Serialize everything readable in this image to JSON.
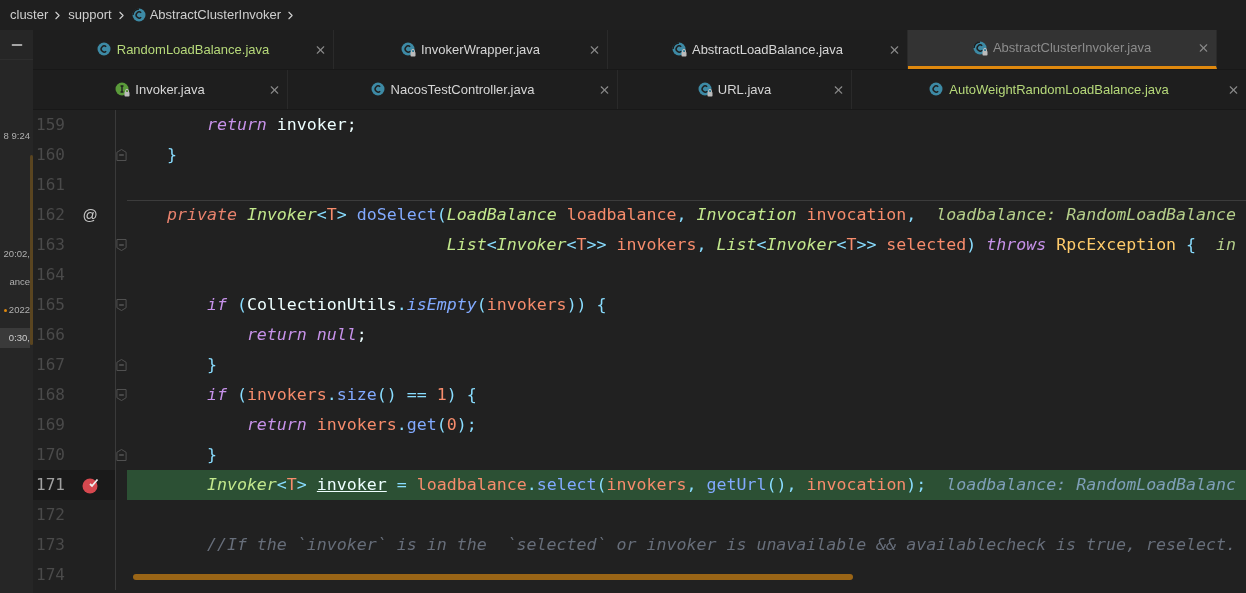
{
  "breadcrumb": [
    {
      "text": "cluster",
      "kind": "plain"
    },
    {
      "text": "support",
      "kind": "plain"
    },
    {
      "text": "AbstractClusterInvoker",
      "kind": "abstract"
    }
  ],
  "left_panel": {
    "items": [
      {
        "text": "8 9:24",
        "selected": false
      },
      {
        "text": "20:02,",
        "selected": false
      },
      {
        "text": "ance",
        "selected": false
      },
      {
        "text": "2022",
        "marker": true,
        "selected": false
      },
      {
        "text": "0:30,",
        "selected": true
      }
    ]
  },
  "tab_rows": [
    {
      "tabs": [
        {
          "label": "RandomLoadBalance.java",
          "kind": "class",
          "locked": false,
          "added": true,
          "selected": false
        },
        {
          "label": "InvokerWrapper.java",
          "kind": "class",
          "locked": true,
          "added": false,
          "selected": false
        },
        {
          "label": "AbstractLoadBalance.java",
          "kind": "abstract",
          "locked": true,
          "added": false,
          "selected": false
        },
        {
          "label": "AbstractClusterInvoker.java",
          "kind": "abstract",
          "locked": true,
          "added": false,
          "selected": true
        }
      ]
    },
    {
      "tabs": [
        {
          "label": "Invoker.java",
          "kind": "interface",
          "locked": true,
          "added": false,
          "selected": false
        },
        {
          "label": "NacosTestController.java",
          "kind": "class",
          "locked": false,
          "added": false,
          "selected": false
        },
        {
          "label": "URL.java",
          "kind": "class",
          "locked": true,
          "added": false,
          "selected": false
        },
        {
          "label": "AutoWeightRandomLoadBalance.java",
          "kind": "class",
          "locked": false,
          "added": true,
          "selected": false
        }
      ]
    }
  ],
  "editor": {
    "lines": [
      {
        "number": "159",
        "kind": "plain",
        "current": false,
        "breakpoint": false,
        "code": [
          {
            "text": "        return",
            "kind": "kw"
          },
          {
            "text": " invoker;",
            "kind": "plain"
          }
        ]
      },
      {
        "number": "160",
        "kind": "fold_end",
        "current": false,
        "breakpoint": false,
        "code": [
          {
            "text": "    }",
            "kind": "punct"
          }
        ]
      },
      {
        "number": "161",
        "kind": "plain",
        "current": false,
        "breakpoint": false
      },
      {
        "number": "162",
        "kind": "plain",
        "current": false,
        "breakpoint": false,
        "separator_above": true,
        "annotation": "@",
        "code": [
          {
            "text": "    private",
            "kind": "mod"
          },
          {
            "text": " Invoker",
            "kind": "type"
          },
          {
            "text": "<",
            "kind": "punct"
          },
          {
            "text": "T",
            "kind": "tparam"
          },
          {
            "text": ">",
            "kind": "punct"
          },
          {
            "text": " doSelect",
            "kind": "method"
          },
          {
            "text": "(",
            "kind": "punct"
          },
          {
            "text": "LoadBalance",
            "kind": "type"
          },
          {
            "text": " loadbalance",
            "kind": "param"
          },
          {
            "text": ", ",
            "kind": "punct"
          },
          {
            "text": "Invocation",
            "kind": "type"
          },
          {
            "text": " invocation",
            "kind": "param"
          },
          {
            "text": ",",
            "kind": "punct"
          },
          {
            "text": "  loadbalance: RandomLoadBalance",
            "kind": "hint"
          }
        ]
      },
      {
        "number": "163",
        "kind": "fold_start",
        "current": false,
        "breakpoint": false,
        "code": [
          {
            "text": "                                List",
            "kind": "type"
          },
          {
            "text": "<",
            "kind": "punct"
          },
          {
            "text": "Invoker",
            "kind": "type"
          },
          {
            "text": "<",
            "kind": "punct"
          },
          {
            "text": "T",
            "kind": "tparam"
          },
          {
            "text": ">>",
            "kind": "punct"
          },
          {
            "text": " invokers",
            "kind": "param"
          },
          {
            "text": ", ",
            "kind": "punct"
          },
          {
            "text": "List",
            "kind": "type"
          },
          {
            "text": "<",
            "kind": "punct"
          },
          {
            "text": "Invoker",
            "kind": "type"
          },
          {
            "text": "<",
            "kind": "punct"
          },
          {
            "text": "T",
            "kind": "tparam"
          },
          {
            "text": ">>",
            "kind": "punct"
          },
          {
            "text": " selected",
            "kind": "param"
          },
          {
            "text": ")",
            "kind": "punct"
          },
          {
            "text": " throws",
            "kind": "kw"
          },
          {
            "text": " RpcException",
            "kind": "cls"
          },
          {
            "text": " {",
            "kind": "punct"
          },
          {
            "text": "  in",
            "kind": "hint"
          }
        ]
      },
      {
        "number": "164",
        "kind": "plain",
        "current": false,
        "breakpoint": false
      },
      {
        "number": "165",
        "kind": "fold_start",
        "current": false,
        "breakpoint": false,
        "code": [
          {
            "text": "        if",
            "kind": "kw"
          },
          {
            "text": " (",
            "kind": "punct"
          },
          {
            "text": "CollectionUtils",
            "kind": "plain"
          },
          {
            "text": ".",
            "kind": "punct"
          },
          {
            "text": "isEmpty",
            "kind": "method_static"
          },
          {
            "text": "(",
            "kind": "punct"
          },
          {
            "text": "invokers",
            "kind": "param"
          },
          {
            "text": ")) {",
            "kind": "punct"
          }
        ]
      },
      {
        "number": "166",
        "kind": "plain",
        "current": false,
        "breakpoint": false,
        "code": [
          {
            "text": "            return",
            "kind": "kw"
          },
          {
            "text": " null",
            "kind": "kw"
          },
          {
            "text": ";",
            "kind": "plain"
          }
        ]
      },
      {
        "number": "167",
        "kind": "fold_end",
        "current": false,
        "breakpoint": false,
        "code": [
          {
            "text": "        }",
            "kind": "punct"
          }
        ]
      },
      {
        "number": "168",
        "kind": "fold_start",
        "current": false,
        "breakpoint": false,
        "code": [
          {
            "text": "        if",
            "kind": "kw"
          },
          {
            "text": " (",
            "kind": "punct"
          },
          {
            "text": "invokers",
            "kind": "param"
          },
          {
            "text": ".",
            "kind": "punct"
          },
          {
            "text": "size",
            "kind": "method"
          },
          {
            "text": "() ==",
            "kind": "punct"
          },
          {
            "text": " 1",
            "kind": "num"
          },
          {
            "text": ") {",
            "kind": "punct"
          }
        ]
      },
      {
        "number": "169",
        "kind": "plain",
        "current": false,
        "breakpoint": false,
        "code": [
          {
            "text": "            return",
            "kind": "kw"
          },
          {
            "text": " invokers",
            "kind": "param"
          },
          {
            "text": ".",
            "kind": "punct"
          },
          {
            "text": "get",
            "kind": "method"
          },
          {
            "text": "(",
            "kind": "punct"
          },
          {
            "text": "0",
            "kind": "num"
          },
          {
            "text": ");",
            "kind": "punct"
          }
        ]
      },
      {
        "number": "170",
        "kind": "fold_end",
        "current": false,
        "breakpoint": false,
        "code": [
          {
            "text": "        }",
            "kind": "punct"
          }
        ]
      },
      {
        "number": "171",
        "kind": "plain",
        "current": true,
        "breakpoint": true,
        "code": [
          {
            "text": "        Invoker",
            "kind": "type"
          },
          {
            "text": "<",
            "kind": "punct"
          },
          {
            "text": "T",
            "kind": "tparam"
          },
          {
            "text": "> ",
            "kind": "punct"
          },
          {
            "text": "invoker",
            "kind": "var_def"
          },
          {
            "text": " =",
            "kind": "punct"
          },
          {
            "text": " loadbalance",
            "kind": "param"
          },
          {
            "text": ".",
            "kind": "punct"
          },
          {
            "text": "select",
            "kind": "method"
          },
          {
            "text": "(",
            "kind": "punct"
          },
          {
            "text": "invokers",
            "kind": "param"
          },
          {
            "text": ", ",
            "kind": "punct"
          },
          {
            "text": "getUrl",
            "kind": "method"
          },
          {
            "text": "(), ",
            "kind": "punct"
          },
          {
            "text": "invocation",
            "kind": "param"
          },
          {
            "text": ");",
            "kind": "punct"
          },
          {
            "text": "  loadbalance: RandomLoadBalanc",
            "kind": "hint"
          }
        ]
      },
      {
        "number": "172",
        "kind": "plain",
        "current": false,
        "breakpoint": false
      },
      {
        "number": "173",
        "kind": "plain",
        "current": false,
        "breakpoint": false,
        "code": [
          {
            "text": "        //If the `invoker` is in the  `selected` or invoker is unavailable && availablecheck is true, reselect.",
            "kind": "comment"
          }
        ]
      },
      {
        "number": "174",
        "kind": "plain",
        "current": false,
        "breakpoint": false
      }
    ]
  }
}
